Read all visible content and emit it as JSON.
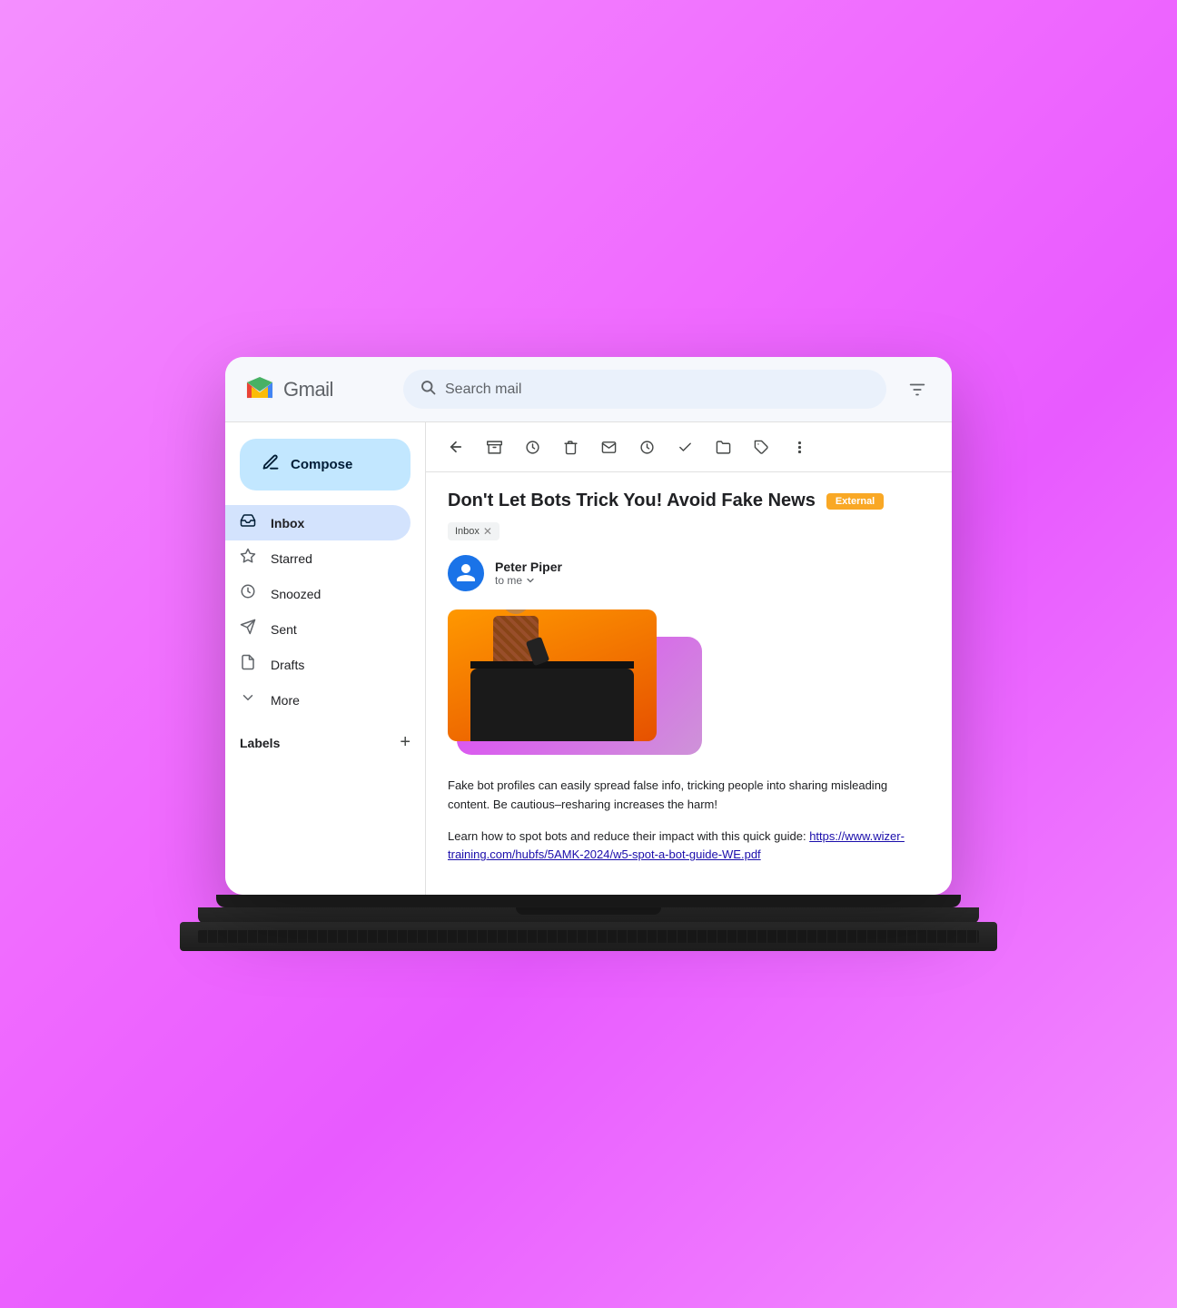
{
  "app": {
    "title": "Gmail",
    "search_placeholder": "Search mail"
  },
  "compose": {
    "label": "Compose"
  },
  "nav": {
    "items": [
      {
        "id": "inbox",
        "label": "Inbox",
        "icon": "inbox",
        "active": true
      },
      {
        "id": "starred",
        "label": "Starred",
        "icon": "star",
        "active": false
      },
      {
        "id": "snoozed",
        "label": "Snoozed",
        "icon": "clock",
        "active": false
      },
      {
        "id": "sent",
        "label": "Sent",
        "icon": "send",
        "active": false
      },
      {
        "id": "drafts",
        "label": "Drafts",
        "icon": "draft",
        "active": false
      },
      {
        "id": "more",
        "label": "More",
        "icon": "chevron-down",
        "active": false
      }
    ]
  },
  "labels": {
    "title": "Labels",
    "add_icon": "+"
  },
  "email": {
    "subject": "Don't Let Bots Trick You! Avoid Fake News",
    "tag_external": "External",
    "tag_inbox": "Inbox",
    "sender_name": "Peter Piper",
    "sender_to": "to me",
    "body_paragraph1": "Fake bot profiles can easily spread false info, tricking people into sharing misleading content. Be cautious–resharing increases the harm!",
    "body_paragraph2": "Learn how to spot bots and reduce their impact with this quick guide:",
    "link_text": "https://www.wizer-training.com/hubfs/5AMK-2024/w5-spot-a-bot-guide-WE.pdf"
  },
  "toolbar": {
    "back": "←",
    "archive": "⬜",
    "snooze": "🕐",
    "delete": "🗑",
    "mark_unread": "✉",
    "remind": "🕐",
    "done": "✓",
    "move": "📁",
    "label": "🏷",
    "more": "⋮"
  }
}
